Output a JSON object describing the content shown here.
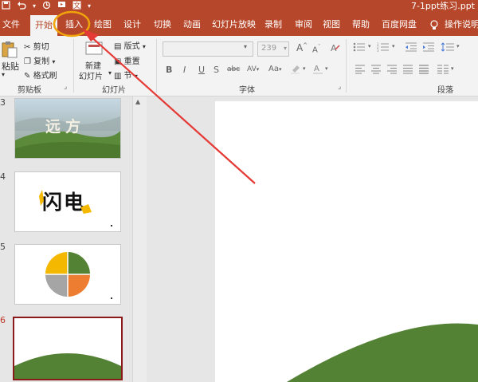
{
  "window": {
    "doc_title": "7-1ppt练习.ppt"
  },
  "qat": {
    "undo_icon": "undo-icon",
    "save_icon": "save-icon"
  },
  "tabs": [
    {
      "label": "文件"
    },
    {
      "label": "开始"
    },
    {
      "label": "插入"
    },
    {
      "label": "绘图"
    },
    {
      "label": "设计"
    },
    {
      "label": "切换"
    },
    {
      "label": "动画"
    },
    {
      "label": "幻灯片放映"
    },
    {
      "label": "录制"
    },
    {
      "label": "审阅"
    },
    {
      "label": "视图"
    },
    {
      "label": "帮助"
    },
    {
      "label": "百度网盘"
    },
    {
      "label": "操作说明"
    }
  ],
  "ribbon": {
    "clipboard": {
      "paste_label": "粘贴",
      "cut_label": "剪切",
      "copy_label": "复制",
      "format_painter_label": "格式刷",
      "group_label": "剪贴板"
    },
    "slides": {
      "new_slide_label_1": "新建",
      "new_slide_label_2": "幻灯片",
      "layout_label": "版式",
      "reset_label": "重置",
      "section_label": "节",
      "group_label": "幻灯片"
    },
    "font": {
      "font_size": "239",
      "bold": "B",
      "italic": "I",
      "underline": "U",
      "strike": "S",
      "shadow": "abc",
      "spacing": "AV",
      "case": "Aa",
      "grow": "A",
      "shrink": "A",
      "group_label": "字体"
    },
    "paragraph": {
      "group_label": "段落"
    }
  },
  "thumbnails": [
    {
      "number": "3",
      "title_text": "远方"
    },
    {
      "number": "4",
      "title_text": "闪电"
    },
    {
      "number": "5"
    },
    {
      "number": "6"
    }
  ],
  "colors": {
    "accent": "#b7472a",
    "annotation_circle": "#f0a30a",
    "annotation_arrow": "#e53935",
    "pie_yellow": "#f5b800",
    "pie_green": "#548235",
    "pie_orange": "#ed7d31",
    "pie_gray": "#a5a5a5",
    "slide_hill_green": "#548235"
  }
}
